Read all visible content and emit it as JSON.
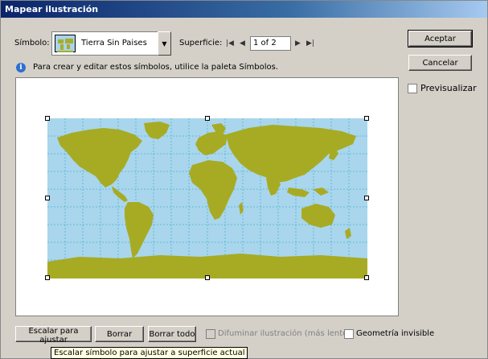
{
  "window": {
    "title": "Mapear ilustración"
  },
  "symbol": {
    "label": "Símbolo:",
    "selected": "Tierra Sin Paises"
  },
  "surface": {
    "label": "Superficie:",
    "page_value": "1 of 2"
  },
  "info_text": "Para crear y editar estos símbolos, utilice la paleta Símbolos.",
  "buttons": {
    "ok": "Aceptar",
    "cancel": "Cancelar",
    "scale_to_fit": "Escalar para ajustar",
    "clear": "Borrar",
    "clear_all": "Borrar todo"
  },
  "options": {
    "preview": {
      "label": "Previsualizar",
      "checked": false
    },
    "shade_artwork": {
      "label": "Difuminar ilustración (más lento)",
      "checked": false,
      "enabled": false
    },
    "invisible_geometry": {
      "label": "Geometría invisible",
      "checked": false
    }
  },
  "tooltip": "Escalar símbolo para ajustar a superficie actual",
  "colors": {
    "ocean": "#a9d6ec",
    "land": "#a7ab24",
    "grid": "#4bb3d6"
  },
  "icons": [
    "combo-dropdown-icon",
    "first-surface-icon",
    "prev-surface-icon",
    "next-surface-icon",
    "last-surface-icon",
    "info-icon"
  ]
}
